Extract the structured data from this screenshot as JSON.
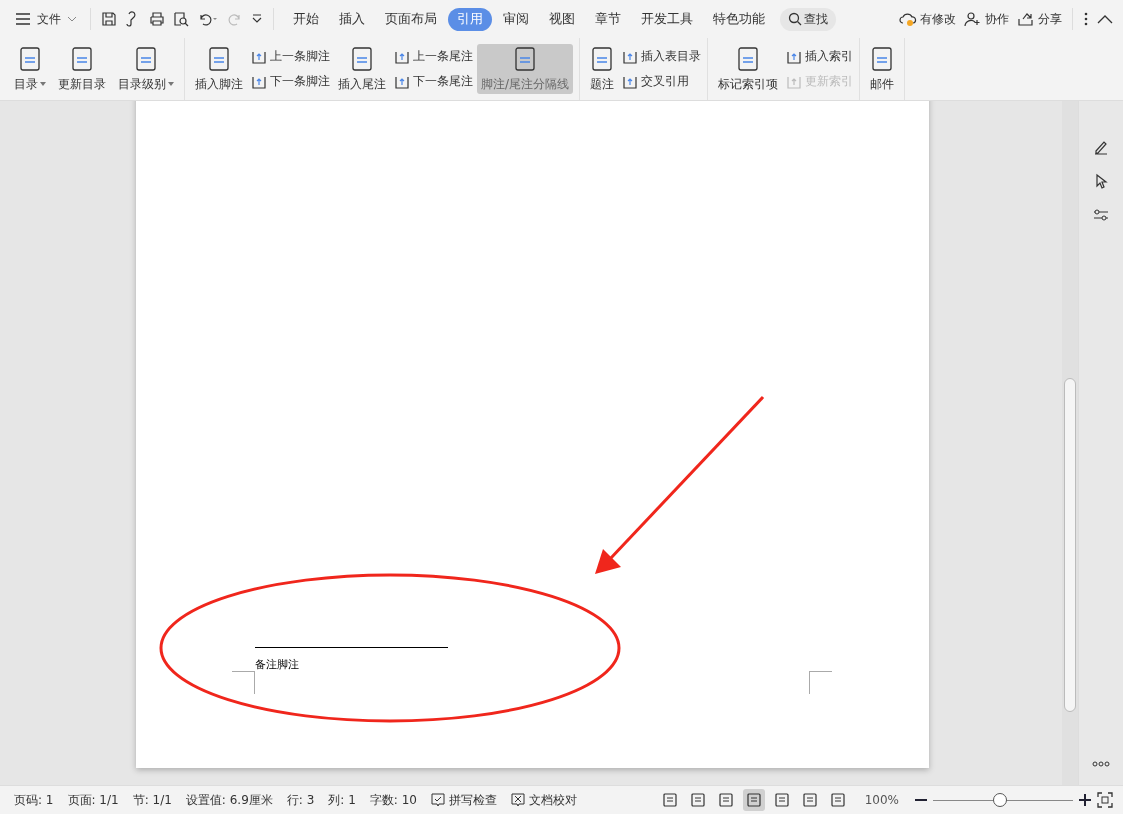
{
  "menu": {
    "file": "文件"
  },
  "tabs": [
    {
      "label": "开始",
      "selected": false
    },
    {
      "label": "插入",
      "selected": false
    },
    {
      "label": "页面布局",
      "selected": false
    },
    {
      "label": "引用",
      "selected": true
    },
    {
      "label": "审阅",
      "selected": false
    },
    {
      "label": "视图",
      "selected": false
    },
    {
      "label": "章节",
      "selected": false
    },
    {
      "label": "开发工具",
      "selected": false
    },
    {
      "label": "特色功能",
      "selected": false
    }
  ],
  "search": {
    "label": "查找"
  },
  "actions": [
    "有修改",
    "协作",
    "分享"
  ],
  "ribbon": {
    "groups": [
      {
        "items": [
          {
            "kind": "large",
            "label": "目录",
            "dropdown": true,
            "active": false
          },
          {
            "kind": "large",
            "label": "更新目录",
            "dropdown": false,
            "active": false
          },
          {
            "kind": "large",
            "label": "目录级别",
            "dropdown": true,
            "active": false
          }
        ]
      },
      {
        "items": [
          {
            "kind": "large",
            "label": "插入脚注",
            "dropdown": false,
            "active": false
          },
          {
            "kind": "small",
            "buttons": [
              {
                "label": "上一条脚注",
                "disabled": false
              },
              {
                "label": "下一条脚注",
                "disabled": false
              }
            ]
          },
          {
            "kind": "large",
            "label": "插入尾注",
            "dropdown": false,
            "active": false
          },
          {
            "kind": "small",
            "buttons": [
              {
                "label": "上一条尾注",
                "disabled": false
              },
              {
                "label": "下一条尾注",
                "disabled": false
              }
            ]
          },
          {
            "kind": "large",
            "label": "脚注/尾注分隔线",
            "dropdown": false,
            "active": true
          }
        ]
      },
      {
        "items": [
          {
            "kind": "large",
            "label": "题注",
            "dropdown": false,
            "active": false
          },
          {
            "kind": "small",
            "buttons": [
              {
                "label": "插入表目录",
                "disabled": false
              },
              {
                "label": "交叉引用",
                "disabled": false
              }
            ]
          }
        ]
      },
      {
        "items": [
          {
            "kind": "large",
            "label": "标记索引项",
            "dropdown": false,
            "active": false
          },
          {
            "kind": "small",
            "buttons": [
              {
                "label": "插入索引",
                "disabled": false
              },
              {
                "label": "更新索引",
                "disabled": true
              }
            ]
          }
        ]
      },
      {
        "items": [
          {
            "kind": "large",
            "label": "邮件",
            "dropdown": false,
            "active": false
          }
        ]
      }
    ]
  },
  "document": {
    "footnote": "备注脚注"
  },
  "status_bar": {
    "items": [
      {
        "kind": "text",
        "label": "页码: 1"
      },
      {
        "kind": "text",
        "label": "页面: 1/1"
      },
      {
        "kind": "text",
        "label": "节: 1/1"
      },
      {
        "kind": "text",
        "label": "设置值: 6.9厘米"
      },
      {
        "kind": "text",
        "label": "行: 3"
      },
      {
        "kind": "text",
        "label": "列: 1"
      },
      {
        "kind": "text",
        "label": "字数: 10"
      },
      {
        "kind": "check",
        "label": "拼写检查"
      },
      {
        "kind": "cross",
        "label": "文档校对"
      }
    ],
    "views": [
      {
        "selected": false
      },
      {
        "selected": false
      },
      {
        "selected": false
      },
      {
        "selected": true
      },
      {
        "selected": false
      },
      {
        "selected": false
      },
      {
        "selected": false
      }
    ],
    "zoom": "100%",
    "zoom_slider": {
      "level": 0.48
    }
  }
}
